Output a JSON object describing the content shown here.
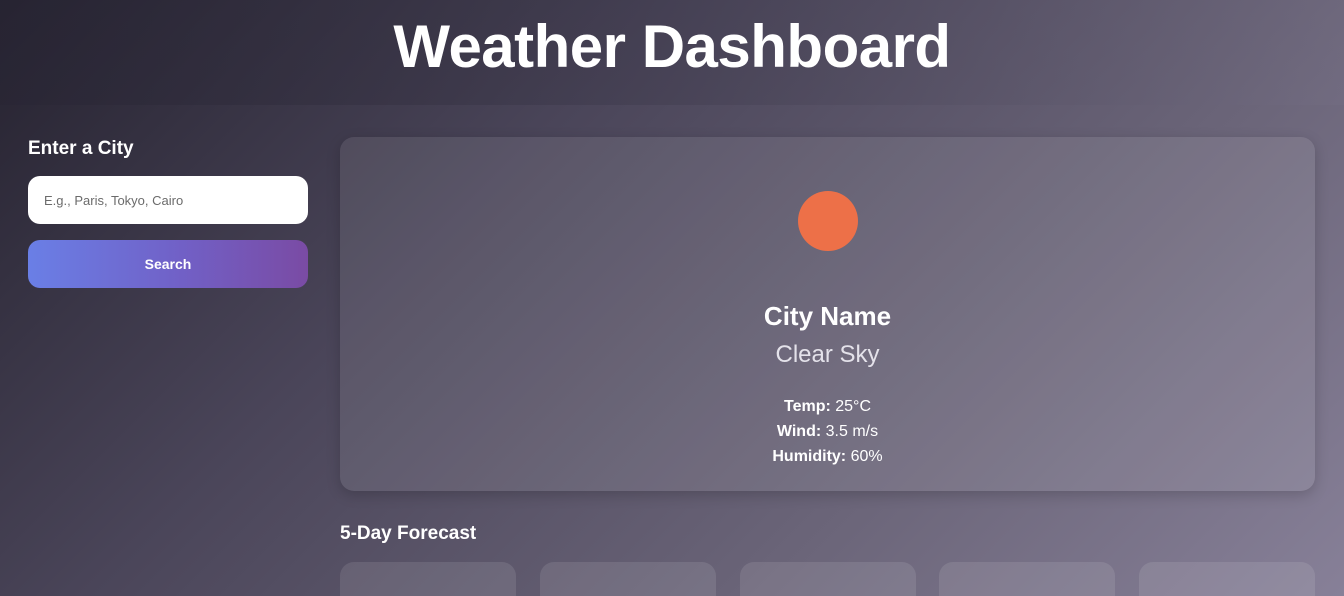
{
  "header": {
    "title": "Weather Dashboard"
  },
  "sidebar": {
    "label": "Enter a City",
    "input_placeholder": "E.g., Paris, Tokyo, Cairo",
    "input_value": "",
    "search_label": "Search"
  },
  "current": {
    "icon": "sun-icon",
    "icon_color": "#ed7048",
    "city": "City Name",
    "condition": "Clear Sky",
    "temp_label": "Temp:",
    "temp_value": "25°C",
    "wind_label": "Wind:",
    "wind_value": "3.5 m/s",
    "humidity_label": "Humidity:",
    "humidity_value": "60%"
  },
  "forecast": {
    "title": "5-Day Forecast",
    "days": [
      {},
      {},
      {},
      {},
      {}
    ]
  },
  "colors": {
    "search_gradient_start": "#6a7fe6",
    "search_gradient_end": "#7a4ba4",
    "background_dark": "#25222f",
    "background_light": "#878098"
  }
}
